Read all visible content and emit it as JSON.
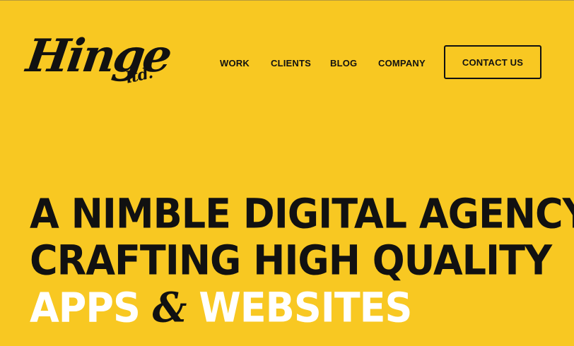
{
  "brand": {
    "logo_main": "Hinge",
    "logo_sub": "ltd."
  },
  "nav": {
    "items": [
      "WORK",
      "CLIENTS",
      "BLOG",
      "COMPANY"
    ],
    "cta": "CONTACT US"
  },
  "hero": {
    "line1": "A NIMBLE DIGITAL AGENCY,",
    "line2": "CRAFTING HIGH QUALITY",
    "line3_part1": "APPS",
    "line3_amp": "&",
    "line3_part2": "WEBSITES"
  },
  "colors": {
    "background": "#F8C822",
    "text_dark": "#111111",
    "text_light": "#FFFFFF"
  }
}
